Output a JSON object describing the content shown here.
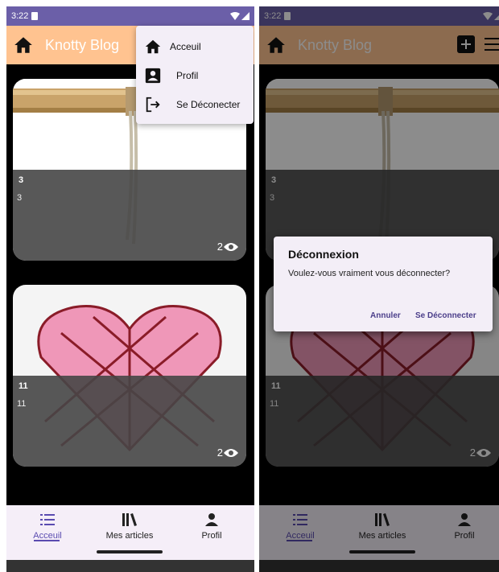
{
  "status": {
    "time": "3:22"
  },
  "appbar": {
    "title": "Knotty Blog"
  },
  "posts": [
    {
      "title": "3",
      "subtitle": "3",
      "views": "2"
    },
    {
      "title": "11",
      "subtitle": "11",
      "views": "2"
    }
  ],
  "menu": {
    "items": [
      {
        "label": "Acceuil"
      },
      {
        "label": "Profil"
      },
      {
        "label": "Se Déconecter"
      }
    ]
  },
  "nav": {
    "items": [
      {
        "label": "Acceuil"
      },
      {
        "label": "Mes articles"
      },
      {
        "label": "Profil"
      }
    ]
  },
  "dialog": {
    "title": "Déconnexion",
    "message": "Voulez-vous vraiment vous déconnecter?",
    "cancel": "Annuler",
    "confirm": "Se Déconnecter"
  },
  "colors": {
    "accent": "#5a4bb0",
    "appbar": "#ffc390",
    "statusbar": "#6b5fa8"
  }
}
